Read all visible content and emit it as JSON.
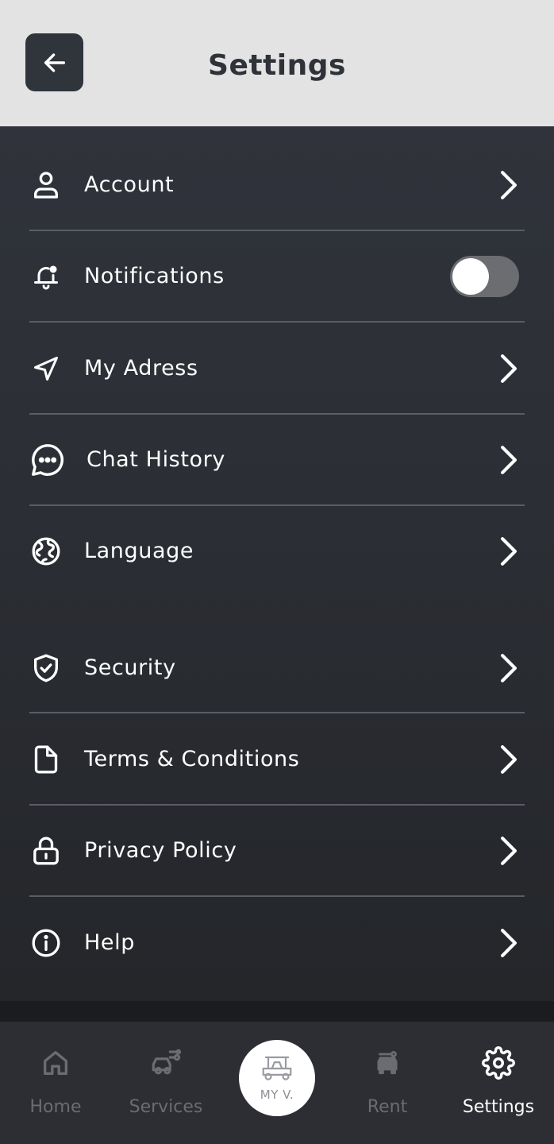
{
  "header": {
    "title": "Settings",
    "back_icon": "arrow-left-icon"
  },
  "settings": {
    "items": [
      {
        "label": "Account",
        "icon": "user-icon",
        "control": "chevron"
      },
      {
        "label": "Notifications",
        "icon": "bell-icon",
        "control": "toggle",
        "toggle_on": false
      },
      {
        "label": "My Adress",
        "icon": "navigation-arrow-icon",
        "control": "chevron"
      },
      {
        "label": "Chat History",
        "icon": "chat-bubble-icon",
        "control": "chevron"
      },
      {
        "label": "Language",
        "icon": "globe-icon",
        "control": "chevron"
      },
      {
        "label": "Security",
        "icon": "shield-check-icon",
        "control": "chevron"
      },
      {
        "label": "Terms & Conditions",
        "icon": "document-icon",
        "control": "chevron"
      },
      {
        "label": "Privacy Policy",
        "icon": "lock-icon",
        "control": "chevron"
      },
      {
        "label": "Help",
        "icon": "info-icon",
        "control": "chevron"
      }
    ]
  },
  "bottom_nav": {
    "items": [
      {
        "label": "Home",
        "icon": "home-icon",
        "active": false
      },
      {
        "label": "Services",
        "icon": "car-service-icon",
        "active": false
      },
      {
        "label": "MY V.",
        "icon": "golf-cart-icon",
        "active": false
      },
      {
        "label": "Rent",
        "icon": "rent-car-icon",
        "active": false
      },
      {
        "label": "Settings",
        "icon": "gear-icon",
        "active": true
      }
    ]
  },
  "colors": {
    "header_bg": "#e3e3e3",
    "content_bg": "#2b2e34",
    "text": "#ffffff",
    "inactive_nav": "#6a6c72"
  }
}
